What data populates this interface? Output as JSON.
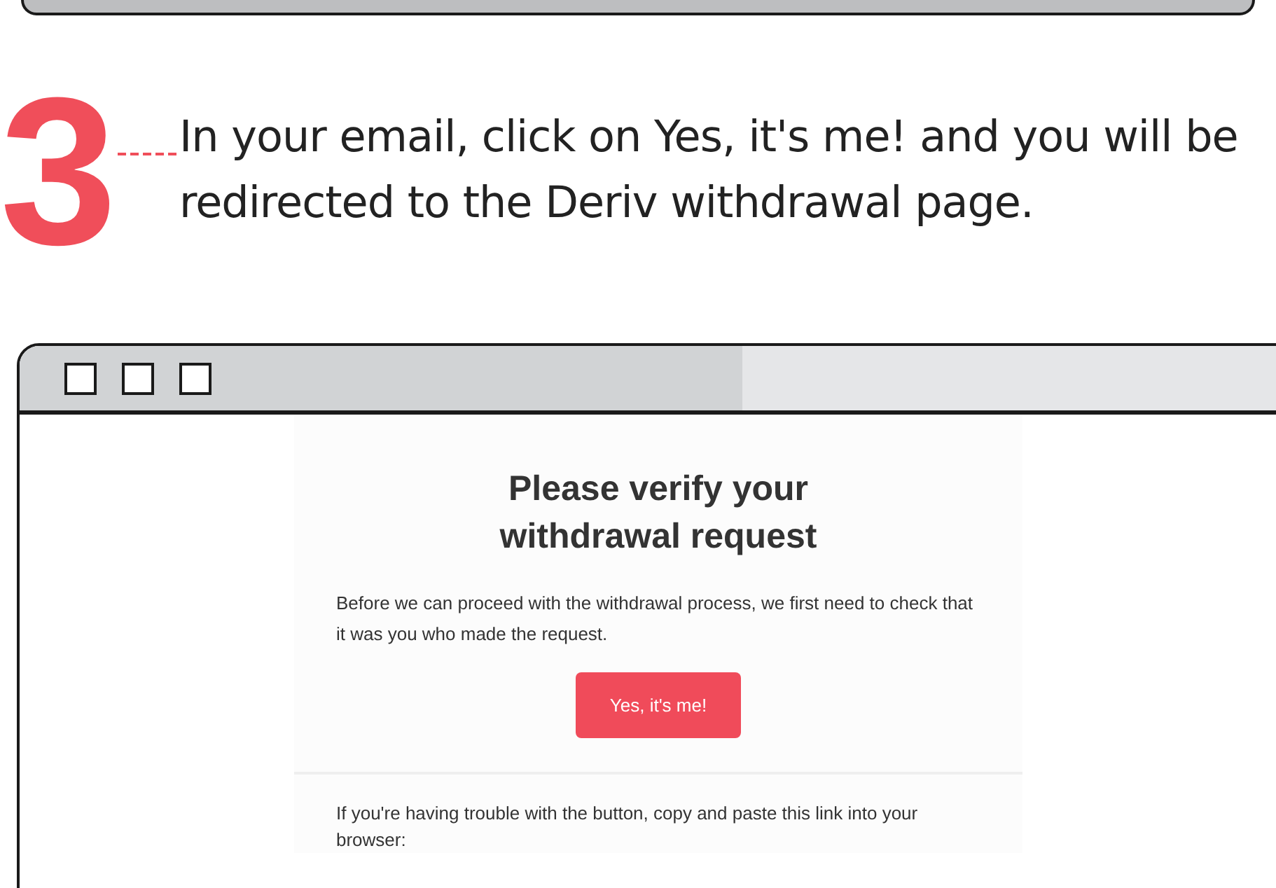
{
  "step": {
    "number": "3",
    "text": "In your email, click on Yes, it's me! and you will be redirected to the Deriv withdrawal page."
  },
  "browser": {
    "window_controls": [
      {
        "kind": "square"
      },
      {
        "kind": "square"
      },
      {
        "kind": "square"
      }
    ]
  },
  "email": {
    "heading": "Please verify your withdrawal request",
    "intro": "Before we can proceed with the withdrawal process, we first need to check that it was you who made the request.",
    "button": "Yes, it's me!",
    "fallback": "If you're having trouble with the button, copy and paste this link into your browser:"
  }
}
